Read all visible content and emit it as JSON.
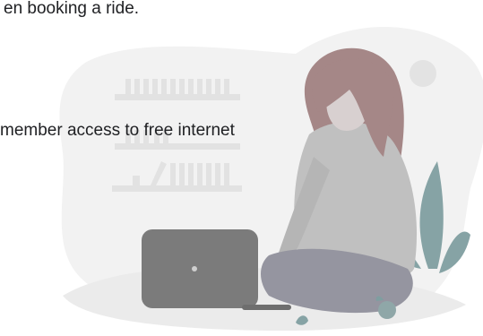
{
  "text": {
    "line_1": "en booking a ride.",
    "line_2": "member access to free internet"
  },
  "illustration": {
    "subject": "person-with-laptop",
    "colors": {
      "background_blob": "#f0f0f0",
      "hair": "#a08484",
      "shirt": "#bdbdbd",
      "pants": "#8f8f9a",
      "laptop": "#7a7a7a",
      "plant": "#7f9ea0",
      "shelf": "#e2e2e2"
    }
  }
}
